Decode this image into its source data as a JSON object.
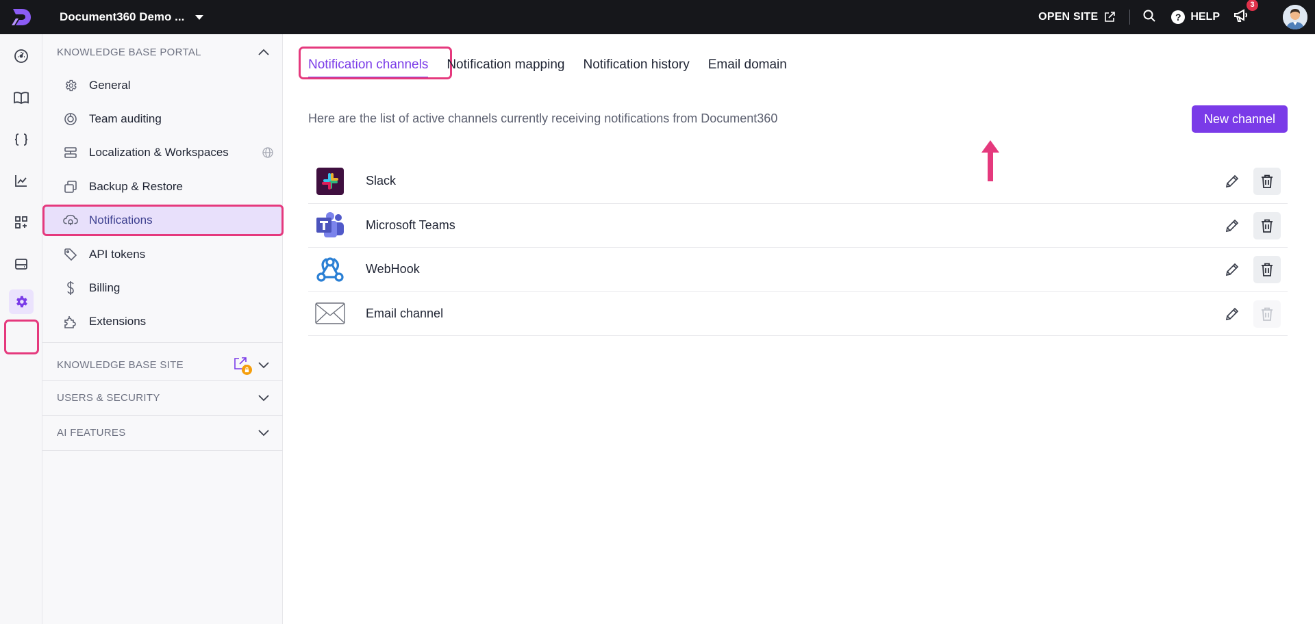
{
  "topbar": {
    "project_name": "Document360 Demo ...",
    "open_site_label": "OPEN SITE",
    "help_label": "HELP",
    "help_glyph": "?",
    "notification_count": "3"
  },
  "rail": {
    "icons": [
      "dashboard-icon",
      "documents-icon",
      "api-docs-icon",
      "analytics-icon",
      "marketplace-icon",
      "drive-icon",
      "settings-icon"
    ],
    "active": "settings-icon"
  },
  "sidebar": {
    "portal_heading": "KNOWLEDGE BASE PORTAL",
    "items": [
      {
        "label": "General",
        "icon": "gear-icon"
      },
      {
        "label": "Team auditing",
        "icon": "audit-icon"
      },
      {
        "label": "Localization & Workspaces",
        "icon": "localization-icon"
      },
      {
        "label": "Backup & Restore",
        "icon": "backup-icon"
      },
      {
        "label": "Notifications",
        "icon": "notification-cloud-icon"
      },
      {
        "label": "API tokens",
        "icon": "tag-icon"
      },
      {
        "label": "Billing",
        "icon": "dollar-icon"
      },
      {
        "label": "Extensions",
        "icon": "puzzle-icon"
      }
    ],
    "active_item": "Notifications",
    "site_heading": "KNOWLEDGE BASE SITE",
    "users_heading": "USERS & SECURITY",
    "ai_heading": "AI FEATURES"
  },
  "main": {
    "tabs": [
      {
        "label": "Notification channels",
        "active": true
      },
      {
        "label": "Notification mapping",
        "active": false
      },
      {
        "label": "Notification history",
        "active": false
      },
      {
        "label": "Email domain",
        "active": false
      }
    ],
    "intro_text": "Here are the list of active channels currently receiving notifications from Document360",
    "new_channel_label": "New channel",
    "channels": [
      {
        "name": "Slack",
        "icon": "slack-icon",
        "delete_enabled": true
      },
      {
        "name": "Microsoft Teams",
        "icon": "teams-icon",
        "delete_enabled": true
      },
      {
        "name": "WebHook",
        "icon": "webhook-icon",
        "delete_enabled": true
      },
      {
        "name": "Email channel",
        "icon": "envelope-icon",
        "delete_enabled": false
      }
    ]
  },
  "colors": {
    "accent": "#7a3be8",
    "highlight": "#e5397d",
    "topbar_bg": "#16171b"
  }
}
